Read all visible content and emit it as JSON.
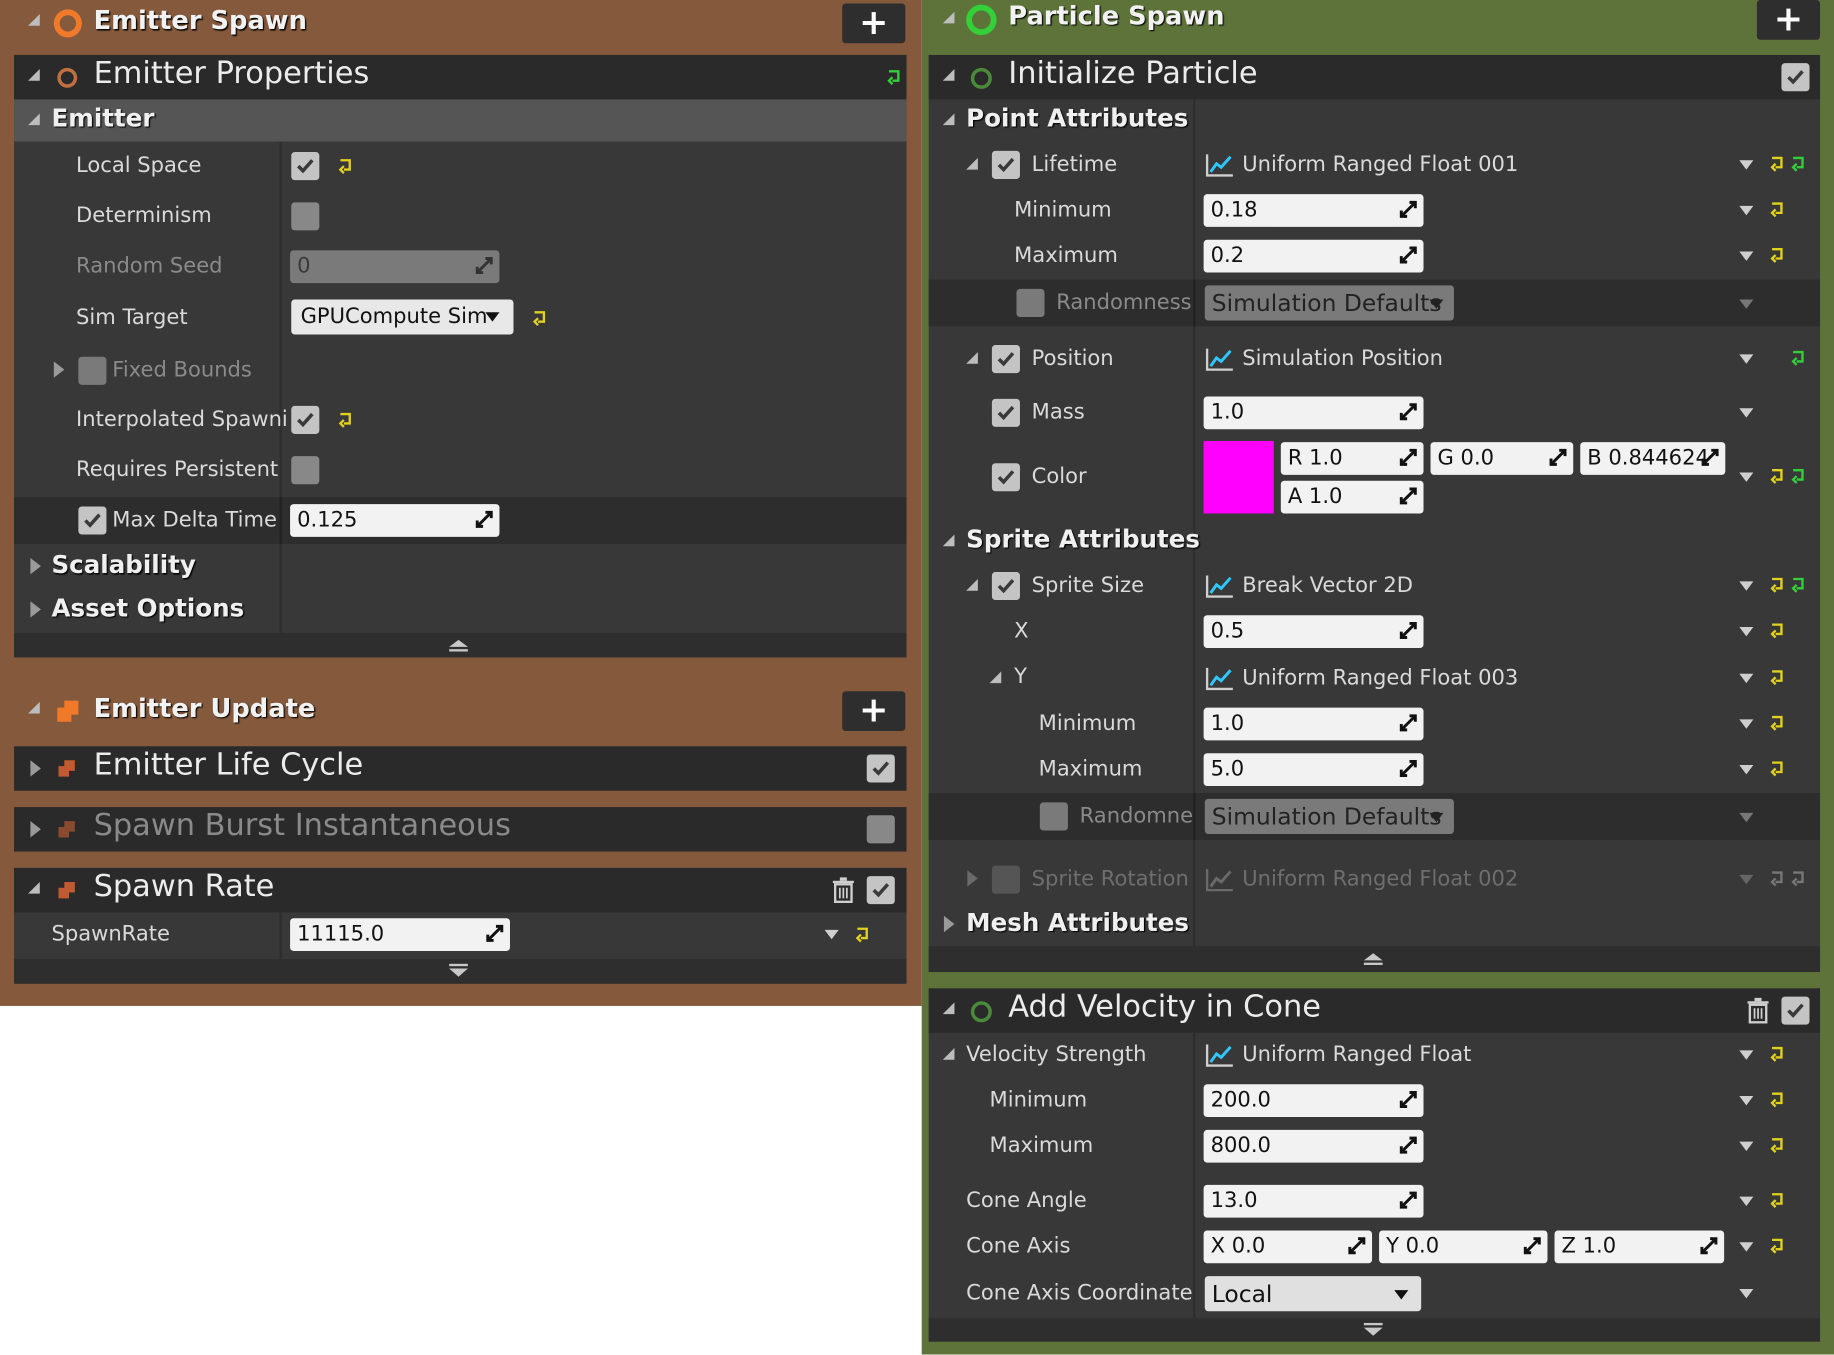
{
  "colors": {
    "emitter_bg": "#84593c",
    "particle_bg": "#5d7339",
    "panel": "#383838",
    "row_dark": "#2c2c2c",
    "accent_green": "#34d03a",
    "accent_yellow": "#e2d21c",
    "color_swatch": "#ff00ff"
  },
  "emitter_spawn": {
    "title": "Emitter Spawn",
    "add": "+",
    "module_title": "Emitter Properties",
    "category": "Emitter",
    "rows": {
      "local_space": "Local Space",
      "determinism": "Determinism",
      "random_seed": "Random Seed",
      "random_seed_value": "0",
      "sim_target": "Sim Target",
      "sim_target_value": "GPUCompute Sim",
      "fixed_bounds": "Fixed Bounds",
      "interpolated": "Interpolated Spawni",
      "requires": "Requires Persistent",
      "max_delta": "Max Delta Time",
      "max_delta_value": "0.125"
    },
    "scalability": "Scalability",
    "asset_options": "Asset Options"
  },
  "emitter_update": {
    "title": "Emitter Update",
    "add": "+",
    "life_cycle": "Emitter Life Cycle",
    "spawn_burst": "Spawn Burst Instantaneous",
    "spawn_rate": "Spawn Rate",
    "spawn_rate_label": "SpawnRate",
    "spawn_rate_value": "11115.0"
  },
  "particle_spawn": {
    "title": "Particle Spawn",
    "add": "+",
    "init_title": "Initialize Particle",
    "point_attributes": "Point Attributes",
    "lifetime": "Lifetime",
    "lifetime_value": "Uniform Ranged Float 001",
    "minimum": "Minimum",
    "maximum": "Maximum",
    "lifetime_min": "0.18",
    "lifetime_max": "0.2",
    "randomness": "Randomness",
    "randomness_value": "Simulation Defaults",
    "position": "Position",
    "position_value": "Simulation Position",
    "mass": "Mass",
    "mass_value": "1.0",
    "color": "Color",
    "color_r": "R  1.0",
    "color_g": "G  0.0",
    "color_b": "B  0.844624",
    "color_a": "A  1.0",
    "sprite_attributes": "Sprite Attributes",
    "sprite_size": "Sprite Size",
    "sprite_size_value": "Break Vector 2D",
    "x": "X",
    "x_value": "0.5",
    "y": "Y",
    "y_value": "Uniform Ranged Float 003",
    "y_min": "1.0",
    "y_max": "5.0",
    "randomne": "Randomne",
    "randomne_value": "Simulation Defaults",
    "sprite_rotation": "Sprite Rotation",
    "sprite_rotation_value": "Uniform Ranged Float 002",
    "mesh_attributes": "Mesh Attributes"
  },
  "add_velocity": {
    "title": "Add Velocity in Cone",
    "velocity_strength": "Velocity Strength",
    "velocity_value": "Uniform Ranged Float",
    "minimum": "Minimum",
    "maximum": "Maximum",
    "min_value": "200.0",
    "max_value": "800.0",
    "cone_angle": "Cone Angle",
    "cone_angle_value": "13.0",
    "cone_axis": "Cone Axis",
    "axis_x": "X  0.0",
    "axis_y": "Y  0.0",
    "axis_z": "Z  1.0",
    "cone_axis_coord": "Cone Axis Coordinate",
    "coord_value": "Local"
  }
}
